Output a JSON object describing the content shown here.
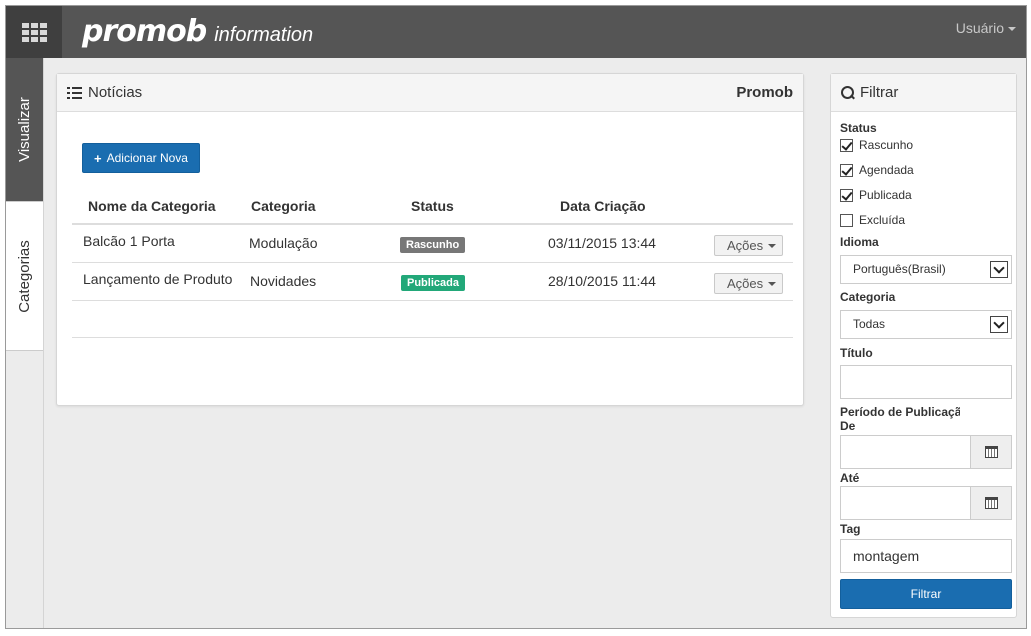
{
  "header": {
    "brand_name": "promob",
    "brand_sub": "information",
    "user_label": "Usuário"
  },
  "side_tabs": [
    {
      "label": "Visualizar",
      "active": true
    },
    {
      "label": "Categorias",
      "active": false
    }
  ],
  "main_panel": {
    "title": "Notícias",
    "brand": "Promob",
    "add_button_label": "Adicionar Nova",
    "columns": [
      "Nome da Categoria",
      "Categoria",
      "Status",
      "Data Criação"
    ],
    "rows": [
      {
        "name": "Balcão 1 Porta",
        "category": "Modulação",
        "status": "Rascunho",
        "status_color": "#777777",
        "date": "03/11/2015 13:44",
        "actions": "Ações"
      },
      {
        "name": "Lançamento de Produto",
        "category": "Novidades",
        "status": "Publicada",
        "status_color": "#22a879",
        "date": "28/10/2015 11:44",
        "actions": "Ações"
      }
    ]
  },
  "filter": {
    "title": "Filtrar",
    "status_label": "Status",
    "statuses": [
      {
        "label": "Rascunho",
        "checked": true
      },
      {
        "label": "Agendada",
        "checked": true
      },
      {
        "label": "Publicada",
        "checked": true
      },
      {
        "label": "Excluída",
        "checked": false
      }
    ],
    "language_label": "Idioma",
    "language_value": "Português(Brasil)",
    "category_label": "Categoria",
    "category_value": "Todas",
    "title_label": "Título",
    "title_value": "",
    "period_label": "Período de Publicação",
    "from_label": "De",
    "to_label": "Até",
    "tag_label": "Tag",
    "tag_value": "montagem",
    "submit_label": "Filtrar"
  },
  "colors": {
    "topbar": "#555555",
    "primary_button": "#1a6db0",
    "badge_draft": "#777777",
    "badge_published": "#22a879"
  }
}
